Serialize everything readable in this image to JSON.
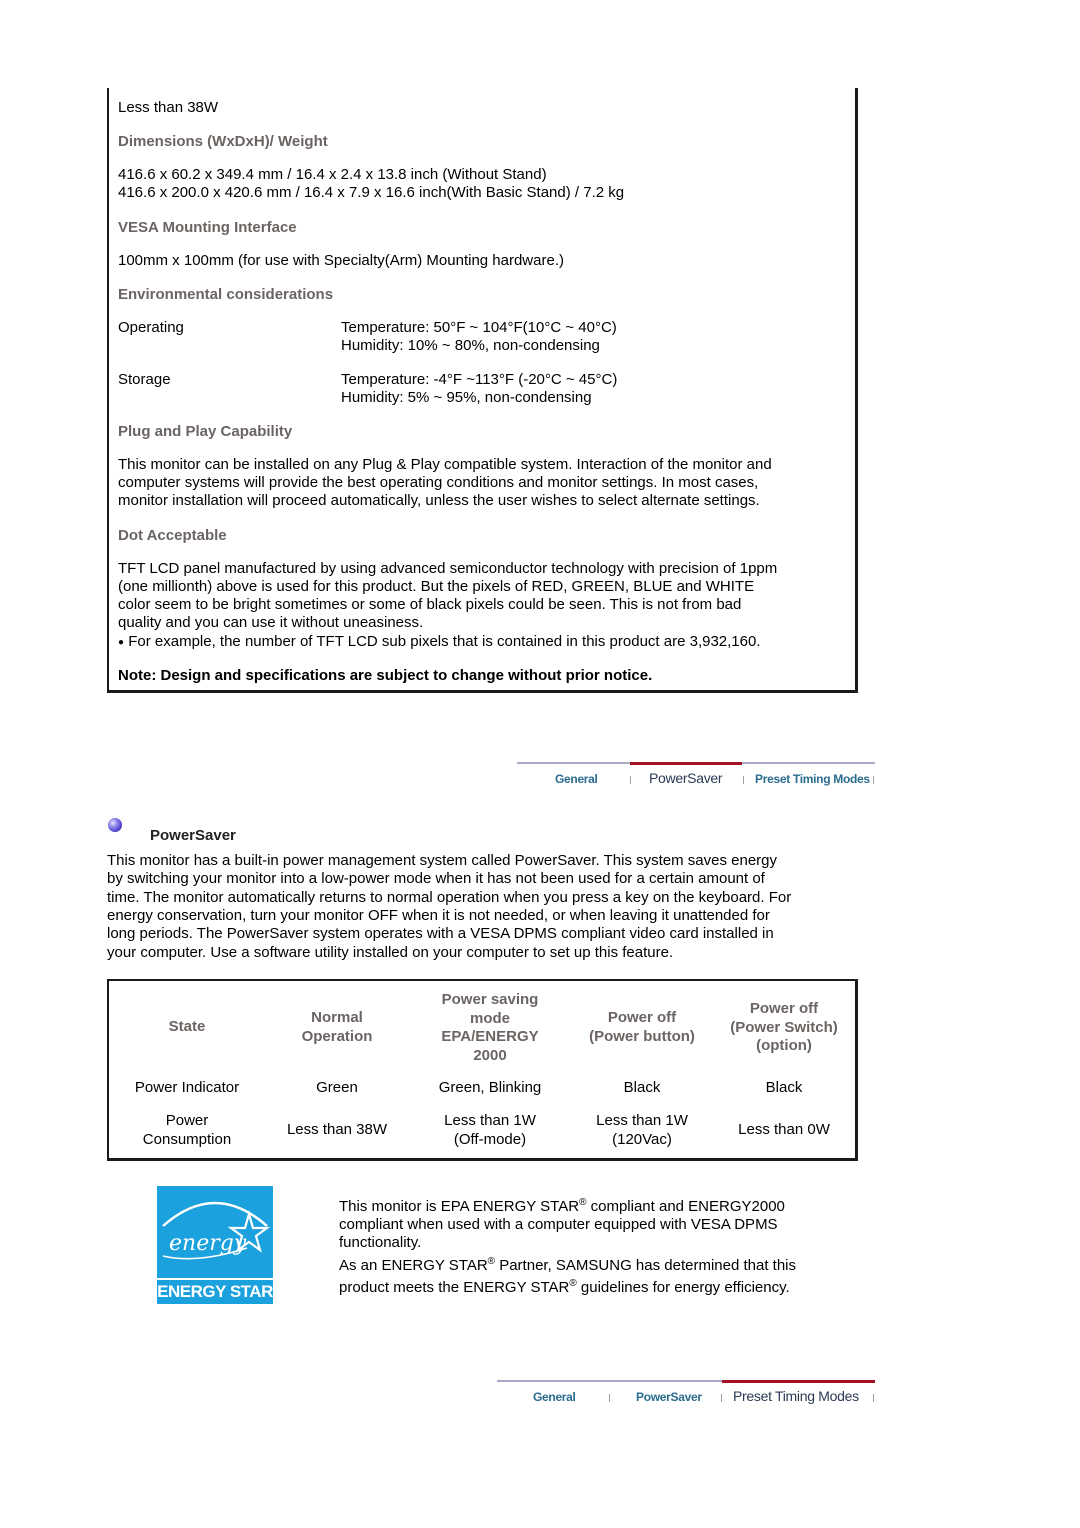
{
  "spec": {
    "power_consumption_tail": "Less than 38W",
    "dimensions": {
      "heading": "Dimensions (WxDxH)/ Weight",
      "line1": "416.6 x 60.2 x 349.4 mm / 16.4 x 2.4 x 13.8 inch (Without Stand)",
      "line2": "416.6 x 200.0 x 420.6 mm / 16.4 x 7.9 x 16.6 inch(With Basic Stand) / 7.2 kg"
    },
    "vesa": {
      "heading": "VESA Mounting Interface",
      "text": "100mm x 100mm (for use with Specialty(Arm) Mounting hardware.)"
    },
    "environment": {
      "heading": "Environmental considerations",
      "rows": [
        {
          "label": "Operating",
          "temperature": "Temperature: 50°F ~ 104°F(10°C ~ 40°C)",
          "humidity": "Humidity: 10% ~ 80%, non-condensing"
        },
        {
          "label": "Storage",
          "temperature": "Temperature: -4°F ~113°F (-20°C ~ 45°C)",
          "humidity": "Humidity: 5% ~ 95%, non-condensing"
        }
      ]
    },
    "plug_and_play": {
      "heading": "Plug and Play Capability",
      "lines": [
        "This monitor can be installed on any Plug & Play compatible system. Interaction of the monitor and",
        "computer systems will provide the best operating conditions and monitor settings. In most cases,",
        "monitor installation will proceed automatically, unless the user wishes to select alternate settings."
      ]
    },
    "dot_acceptable": {
      "heading": "Dot Acceptable",
      "lines": [
        "TFT LCD panel manufactured by using advanced semiconductor technology with precision of 1ppm",
        "(one millionth) above is used for this product. But the pixels of RED, GREEN, BLUE and WHITE",
        "color seem to be bright sometimes or some of black pixels could be seen. This is not from bad",
        "quality and you can use it without uneasiness."
      ],
      "bullet": "For example, the number of TFT LCD sub pixels that is contained in this product are 3,932,160."
    },
    "note": "Note: Design and specifications are subject to change without prior notice."
  },
  "nav_top": {
    "tabs": [
      {
        "label": "General",
        "active": false
      },
      {
        "label": "PowerSaver",
        "active": true
      },
      {
        "label": "Preset Timing Modes",
        "active": false
      }
    ]
  },
  "powersaver": {
    "title": "PowerSaver",
    "lines": [
      "This monitor has a built-in power management system called PowerSaver. This system saves energy",
      "by switching your monitor into a low-power mode when it has not been used for a certain amount of",
      "time. The monitor automatically returns to normal operation when you press a key on the keyboard. For",
      "energy conservation, turn your monitor OFF when it is not needed, or when leaving it unattended for",
      "long periods. The PowerSaver system operates with a VESA DPMS compliant video card installed in",
      "your computer. Use a software utility installed on your computer to set up this feature."
    ],
    "table": {
      "headers": [
        [
          "State"
        ],
        [
          "Normal",
          "Operation"
        ],
        [
          "Power saving",
          "mode",
          "EPA/ENERGY",
          "2000"
        ],
        [
          "Power off",
          "(Power button)"
        ],
        [
          "Power off",
          "(Power Switch)",
          "(option)"
        ]
      ],
      "rows": [
        [
          [
            "Power Indicator"
          ],
          [
            "Green"
          ],
          [
            "Green, Blinking"
          ],
          [
            "Black"
          ],
          [
            "Black"
          ]
        ],
        [
          [
            "Power",
            "Consumption"
          ],
          [
            "Less than 38W"
          ],
          [
            "Less than 1W",
            "(Off-mode)"
          ],
          [
            "Less than 1W",
            "(120Vac)"
          ],
          [
            "Less than 0W"
          ]
        ]
      ]
    }
  },
  "energy_star": {
    "logo_script": "energy",
    "logo_label": "ENERGY STAR",
    "brand_color": "#1ba1dd",
    "p1_a": "This monitor is EPA ENERGY STAR",
    "reg": "®",
    "p1_b": " compliant and ENERGY2000",
    "p1_line2": "compliant when used with a computer equipped with VESA DPMS",
    "p1_line3": "functionality.",
    "p2_a": "As an ENERGY STAR",
    "p2_b": " Partner, SAMSUNG has determined that this",
    "p2_c": "product meets the ENERGY STAR",
    "p2_d": " guidelines for energy efficiency."
  },
  "nav_bottom": {
    "tabs": [
      {
        "label": "General",
        "active": false
      },
      {
        "label": "PowerSaver",
        "active": false
      },
      {
        "label": "Preset Timing Modes",
        "active": true
      }
    ]
  },
  "colors": {
    "heading": "#6b6462",
    "tab_text": "#2a6c8e",
    "tab_active_underline": "#a31224"
  }
}
